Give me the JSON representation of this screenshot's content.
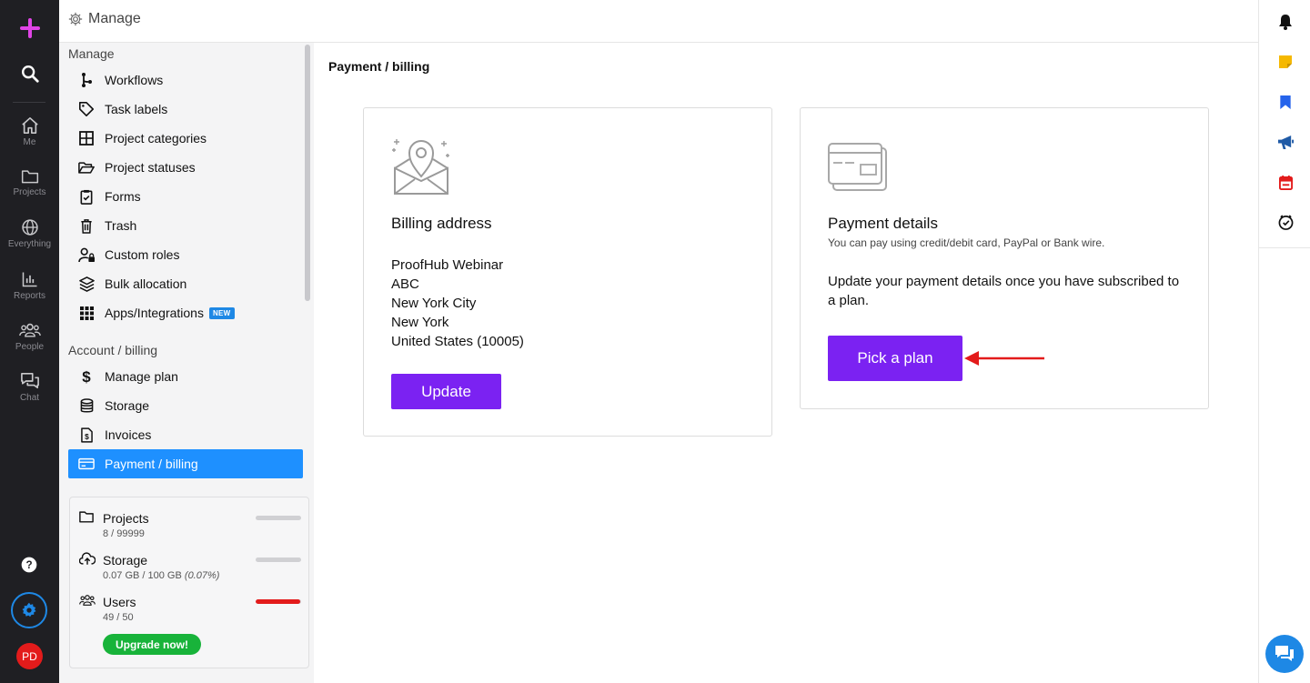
{
  "rail": {
    "items": [
      {
        "label": "Me",
        "icon": "home-icon"
      },
      {
        "label": "Projects",
        "icon": "folder-icon"
      },
      {
        "label": "Everything",
        "icon": "globe-icon"
      },
      {
        "label": "Reports",
        "icon": "chart-icon"
      },
      {
        "label": "People",
        "icon": "people-icon"
      },
      {
        "label": "Chat",
        "icon": "chat-icon"
      }
    ],
    "avatar_initials": "PD"
  },
  "topbar": {
    "title": "Manage"
  },
  "sidebar": {
    "manage_heading": "Manage",
    "manage_items": [
      {
        "label": "Workflows",
        "icon": "workflow-icon"
      },
      {
        "label": "Task labels",
        "icon": "tag-icon"
      },
      {
        "label": "Project categories",
        "icon": "grid-icon"
      },
      {
        "label": "Project statuses",
        "icon": "folder-open-icon"
      },
      {
        "label": "Forms",
        "icon": "clipboard-icon"
      },
      {
        "label": "Trash",
        "icon": "trash-icon"
      },
      {
        "label": "Custom roles",
        "icon": "user-lock-icon"
      },
      {
        "label": "Bulk allocation",
        "icon": "layers-icon"
      },
      {
        "label": "Apps/Integrations",
        "icon": "apps-icon",
        "badge": "NEW"
      }
    ],
    "billing_heading": "Account / billing",
    "billing_items": [
      {
        "label": "Manage plan",
        "icon": "dollar-icon"
      },
      {
        "label": "Storage",
        "icon": "database-icon"
      },
      {
        "label": "Invoices",
        "icon": "invoice-icon"
      },
      {
        "label": "Payment / billing",
        "icon": "credit-card-icon",
        "active": true
      }
    ],
    "usage": {
      "projects": {
        "label": "Projects",
        "value": "8 / 99999",
        "fraction": 0.0001
      },
      "storage": {
        "label": "Storage",
        "value": "0.07 GB / 100 GB",
        "pct_text": "(0.07%)",
        "fraction": 0.0007
      },
      "users": {
        "label": "Users",
        "value": "49 / 50",
        "fraction": 0.98
      },
      "upgrade_label": "Upgrade now!"
    }
  },
  "main": {
    "breadcrumb": "Payment / billing",
    "billing_address": {
      "title": "Billing address",
      "lines": [
        "ProofHub Webinar",
        "ABC",
        "New York City",
        "New York",
        "United States (10005)"
      ],
      "button": "Update"
    },
    "payment_details": {
      "title": "Payment details",
      "subtitle": "You can pay using credit/debit card, PayPal or Bank wire.",
      "message": "Update your payment details once you have subscribed to a plan.",
      "button": "Pick a plan"
    }
  },
  "colors": {
    "accent": "#7b22f2",
    "active": "#1e90ff",
    "upgrade": "#18b33a",
    "users_bar": "#e31b1b",
    "arrow": "#e31b1b"
  }
}
